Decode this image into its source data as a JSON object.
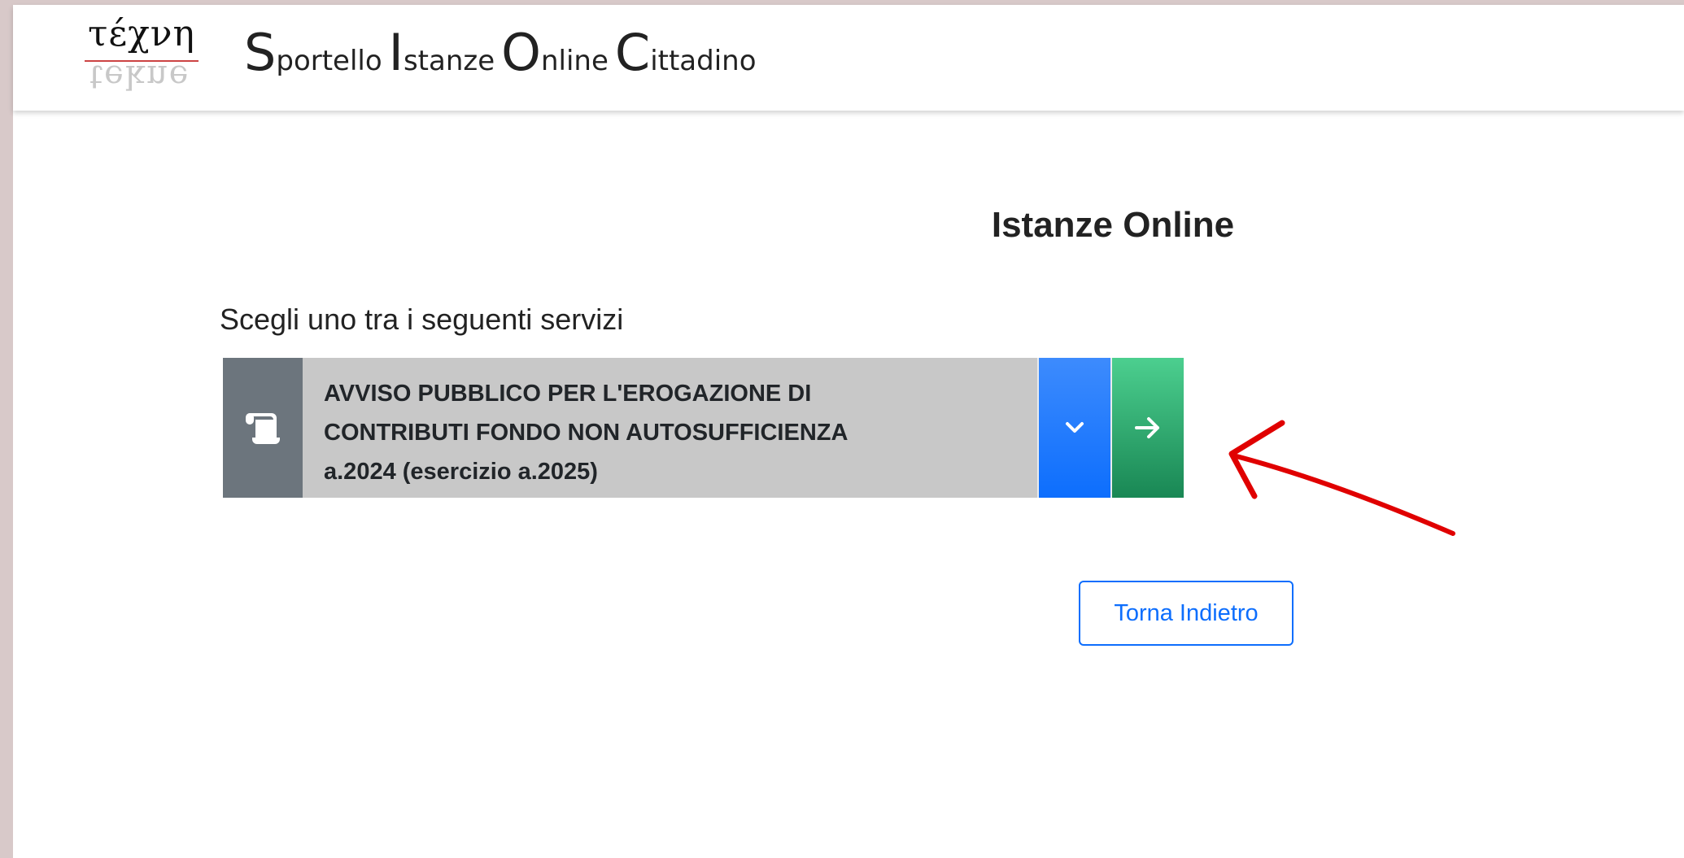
{
  "header": {
    "logo_text_top": "τέχνη",
    "logo_text_bottom": "tekne",
    "title_parts": [
      {
        "cap": "S",
        "rest": "portello"
      },
      {
        "cap": "I",
        "rest": "stanze"
      },
      {
        "cap": "O",
        "rest": "nline"
      },
      {
        "cap": "C",
        "rest": "ittadino"
      }
    ]
  },
  "main": {
    "heading": "Istanze Online",
    "choose_label": "Scegli uno tra i seguenti servizi",
    "services": [
      {
        "icon": "scroll-icon",
        "title_lines": [
          "AVVISO PUBBLICO PER L'EROGAZIONE DI",
          "CONTRIBUTI FONDO NON AUTOSUFFICIENZA",
          "a.2024 (esercizio a.2025)"
        ],
        "expand_icon": "chevron-down-icon",
        "go_icon": "arrow-right-icon"
      }
    ],
    "back_label": "Torna Indietro"
  },
  "colors": {
    "page_border": "#d8c9c9",
    "service_icon_bg": "#6c757d",
    "service_text_bg": "#c8c8c8",
    "expand_button": "#0d6efd",
    "go_button": "#198754",
    "back_button": "#0d6efd",
    "annotation": "#e00000"
  }
}
